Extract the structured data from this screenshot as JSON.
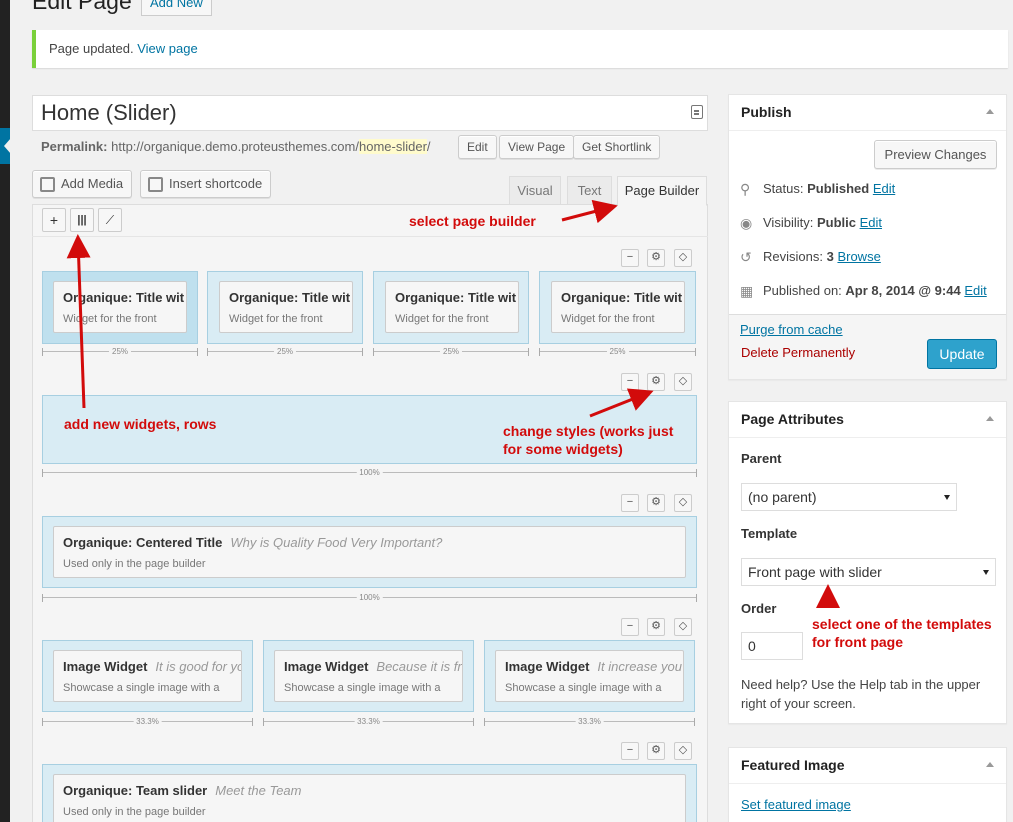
{
  "header": {
    "title": "Edit Page",
    "add_new": "Add New"
  },
  "notice": {
    "text": "Page updated.",
    "link": "View page"
  },
  "editor": {
    "title_value": "Home (Slider)",
    "permalink_label": "Permalink:",
    "permalink_base": "http://organique.demo.proteusthemes.com/",
    "permalink_slug": "home-slider",
    "permalink_end": "/",
    "edit_btn": "Edit",
    "view_page_btn": "View Page",
    "shortlink_btn": "Get Shortlink",
    "add_media": "Add Media",
    "insert_shortcode": "Insert shortcode",
    "tabs": [
      "Visual",
      "Text",
      "Page Builder"
    ],
    "toolbar_icons": [
      "add-icon",
      "columns-icon",
      "brush-icon"
    ]
  },
  "builder": {
    "row1": {
      "widgets": [
        {
          "title": "Organique: Title wit",
          "desc": "Widget for the front"
        },
        {
          "title": "Organique: Title wit",
          "desc": "Widget for the front"
        },
        {
          "title": "Organique: Title wit",
          "desc": "Widget for the front"
        },
        {
          "title": "Organique: Title wit",
          "desc": "Widget for the front"
        }
      ],
      "widths": [
        "25%",
        "25%",
        "25%",
        "25%"
      ]
    },
    "row2": {
      "width": "100%"
    },
    "row3": {
      "title": "Organique: Centered Title",
      "subtitle": "Why is Quality Food Very Important?",
      "desc": "Used only in the page builder",
      "width": "100%"
    },
    "row4": {
      "widgets": [
        {
          "title": "Image Widget",
          "subtitle": "It is good for yo",
          "desc": "Showcase a single image with a"
        },
        {
          "title": "Image Widget",
          "subtitle": "Because it is fr",
          "desc": "Showcase a single image with a"
        },
        {
          "title": "Image Widget",
          "subtitle": "It increase you",
          "desc": "Showcase a single image with a"
        }
      ],
      "widths": [
        "33.3%",
        "33.3%",
        "33.3%"
      ]
    },
    "row5": {
      "title": "Organique: Team slider",
      "subtitle": "Meet the Team",
      "desc": "Used only in the page builder"
    },
    "row_controls": [
      "−",
      "⚙",
      "◇"
    ]
  },
  "annotations": {
    "select_builder": "select page builder",
    "add_widgets": "add new widgets, rows",
    "change_styles_1": "change styles (works just",
    "change_styles_2": "for some widgets)",
    "select_template_1": "select one of the templates",
    "select_template_2": "for front page",
    "color": "#d20b0b"
  },
  "publish": {
    "title": "Publish",
    "preview_btn": "Preview Changes",
    "status_label": "Status:",
    "status_value": "Published",
    "status_edit": "Edit",
    "visibility_label": "Visibility:",
    "visibility_value": "Public",
    "visibility_edit": "Edit",
    "revisions_label": "Revisions:",
    "revisions_value": "3",
    "revisions_link": "Browse",
    "published_label": "Published on:",
    "published_value": "Apr 8, 2014 @ 9:44",
    "published_edit": "Edit",
    "purge": "Purge from cache",
    "delete": "Delete Permanently",
    "update_btn": "Update"
  },
  "attributes": {
    "title": "Page Attributes",
    "parent_label": "Parent",
    "parent_value": "(no parent)",
    "template_label": "Template",
    "template_value": "Front page with slider",
    "order_label": "Order",
    "order_value": "0",
    "help_1": "Need help? Use the Help tab in the upper",
    "help_2": "right of your screen."
  },
  "featured": {
    "title": "Featured Image",
    "link": "Set featured image"
  },
  "colors": {
    "accent": "#0074a2",
    "update_btn": "#2ea2cc",
    "notice_border": "#7ad03a",
    "delete": "#a00"
  }
}
